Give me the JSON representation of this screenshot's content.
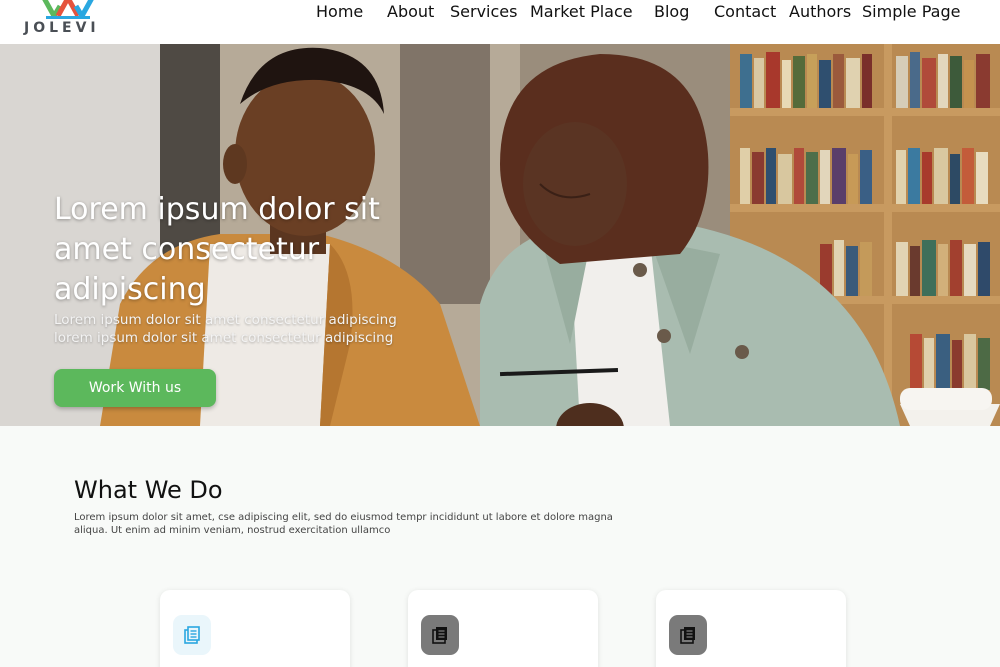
{
  "brand": {
    "name": "JOLEVI",
    "colors": {
      "green": "#5cb85c",
      "blue": "#2aa7e0",
      "red": "#e5533d"
    }
  },
  "nav": {
    "items": [
      {
        "label": "Home"
      },
      {
        "label": "About"
      },
      {
        "label": "Services"
      },
      {
        "label": "Market Place"
      },
      {
        "label": "Blog"
      },
      {
        "label": "Contact"
      },
      {
        "label": "Authors"
      },
      {
        "label": "Simple Page"
      }
    ]
  },
  "hero": {
    "title": "Lorem ipsum dolor sit amet consectetur adipiscing",
    "subtitle": "Lorem ipsum dolor sit amet consectetur adipiscing lorem ipsum dolor sit amet consectetur adipiscing",
    "cta_label": "Work With us",
    "cta_color": "#5cb85c"
  },
  "what_we_do": {
    "title": "What We Do",
    "description": "Lorem ipsum dolor sit amet, cse adipiscing elit, sed do eiusmod tempr incididunt ut labore et dolore magna aliqua. Ut enim ad minim veniam, nostrud exercitation ullamco",
    "cards": [
      {
        "icon": "document-icon",
        "icon_bg": "#eaf6fb",
        "icon_color": "#2aa7e0"
      },
      {
        "icon": "document-icon",
        "icon_bg": "#7a7a7a",
        "icon_color": "#111111"
      },
      {
        "icon": "document-icon",
        "icon_bg": "#7a7a7a",
        "icon_color": "#111111"
      }
    ]
  }
}
